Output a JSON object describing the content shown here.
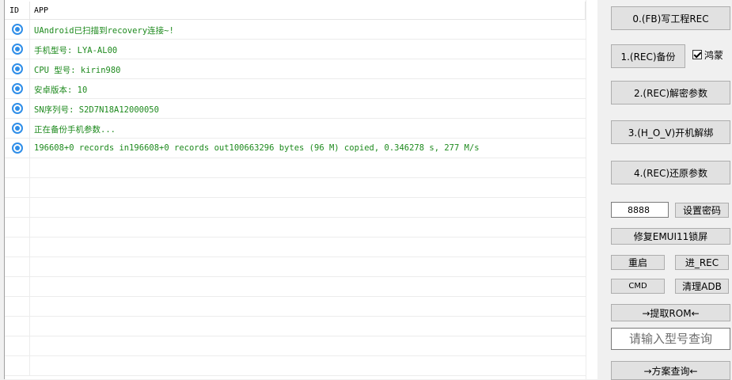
{
  "log": {
    "columns": {
      "id": "ID",
      "app": "APP"
    },
    "rows": [
      {
        "icon": "radio-dot-icon",
        "text": "UAndroid已扫描到recovery连接~!"
      },
      {
        "icon": "radio-dot-icon",
        "text": "手机型号: LYA-AL00"
      },
      {
        "icon": "radio-dot-icon",
        "text": "CPU 型号: kirin980"
      },
      {
        "icon": "radio-dot-icon",
        "text": "安卓版本: 10"
      },
      {
        "icon": "radio-dot-icon",
        "text": "SN序列号: S2D7N18A12000050"
      },
      {
        "icon": "radio-dot-icon",
        "text": "正在备份手机参数..."
      },
      {
        "icon": "radio-dot-icon",
        "text": "196608+0 records in196608+0 records out100663296 bytes (96 M) copied, 0.346278 s, 277 M/s"
      }
    ],
    "colors": {
      "message": "#1e8a1e",
      "icon": "#2f8ee8"
    }
  },
  "panel": {
    "btn0": "0.(FB)写工程REC",
    "btn1": "1.(REC)备份",
    "harmony_checkbox": {
      "label": "鸿蒙",
      "checked": true
    },
    "btn2": "2.(REC)解密参数",
    "btn3": "3.(H_O_V)开机解绑",
    "btn4": "4.(REC)还原参数",
    "password_value": "8888",
    "set_password": "设置密码",
    "fix_emui": "修复EMUI11锁屏",
    "reboot": "重启",
    "enter_rec": "进_REC",
    "cmd": "CMD",
    "clear_adb": "清理ADB",
    "extract_rom": "→提取ROM←",
    "search_placeholder": "请输入型号查询",
    "plan_query": "→方案查询←"
  }
}
